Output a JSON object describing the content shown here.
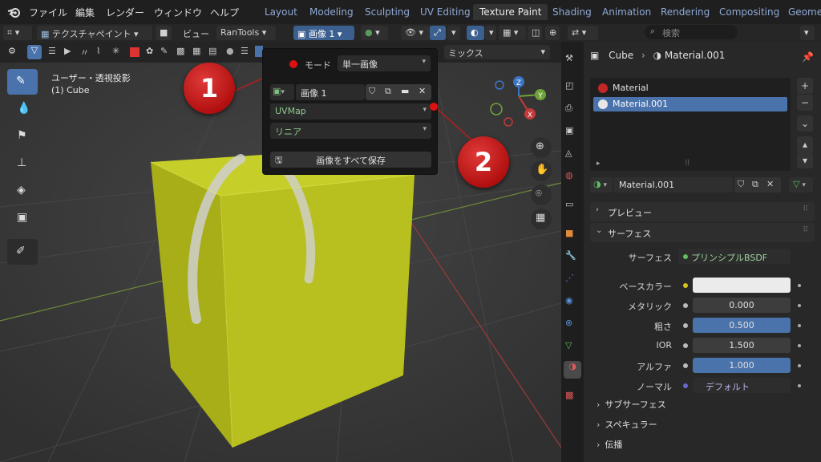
{
  "menubar": {
    "menus": [
      "ファイル",
      "編集",
      "レンダー",
      "ウィンドウ",
      "ヘルプ"
    ],
    "workspaces": [
      "Layout",
      "Modeling",
      "Sculpting",
      "UV Editing",
      "Texture Paint",
      "Shading",
      "Animation",
      "Rendering",
      "Compositing",
      "Geomet"
    ],
    "active_workspace": "Texture Paint"
  },
  "viewport_header": {
    "mode": "テクスチャペイント",
    "view_menu": "ビュー",
    "addon": "RanTools",
    "image": "画像 1",
    "blend": "ミックス"
  },
  "viewport": {
    "view_name": "ユーザー・透視投影",
    "object": "(1) Cube"
  },
  "popover": {
    "mode_label": "モード",
    "mode_value": "単一画像",
    "image_name": "画像 1",
    "uv_map": "UVMap",
    "interpolation": "リニア",
    "save_all": "画像をすべて保存"
  },
  "callouts": [
    "1",
    "2"
  ],
  "gizmo": {
    "x": "X",
    "y": "Y",
    "z": "Z"
  },
  "properties": {
    "search_placeholder": "検索",
    "object_name": "Cube",
    "material_name": "Material.001",
    "materials": [
      "Material",
      "Material.001"
    ],
    "selected_material": "Material.001",
    "panels": {
      "preview": "プレビュー",
      "surface": "サーフェス"
    },
    "surface_label": "サーフェス",
    "surface_shader": "プリンシプルBSDF",
    "fields": [
      {
        "label": "ベースカラー",
        "value": "",
        "dot": "#d4c41a",
        "style": "white"
      },
      {
        "label": "メタリック",
        "value": "0.000",
        "dot": "#bbbbbb",
        "style": "gray"
      },
      {
        "label": "粗さ",
        "value": "0.500",
        "dot": "#bbbbbb",
        "style": "blue"
      },
      {
        "label": "IOR",
        "value": "1.500",
        "dot": "#bbbbbb",
        "style": "gray"
      },
      {
        "label": "アルファ",
        "value": "1.000",
        "dot": "#bbbbbb",
        "style": "blue"
      },
      {
        "label": "ノーマル",
        "value": "デフォルト",
        "dot": "#6b66c9",
        "style": "purple"
      }
    ],
    "sub_panels": [
      "サブサーフェス",
      "スペキュラー",
      "伝播"
    ]
  },
  "colors": {
    "accent": "#4a72ab",
    "cube": "#bcc51f",
    "callout": "#c41a1a"
  }
}
